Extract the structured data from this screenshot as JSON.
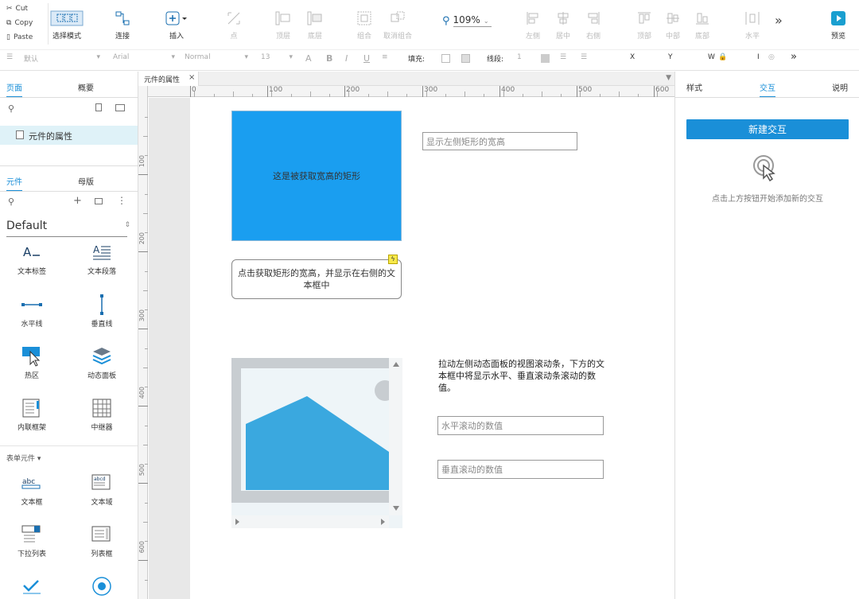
{
  "clipboard": {
    "cut": "Cut",
    "copy": "Copy",
    "paste": "Paste"
  },
  "toolbar": {
    "select_mode": "选择模式",
    "connect": "连接",
    "insert": "插入",
    "point": "点",
    "top_layer": "顶层",
    "bottom_layer": "底层",
    "group": "组合",
    "ungroup": "取消组合",
    "zoom": "109%",
    "align_left": "左侧",
    "align_center": "居中",
    "align_right": "右侧",
    "align_top": "顶部",
    "align_middle": "中部",
    "align_bottom": "底部",
    "horizontal": "水平",
    "more": "»",
    "preview": "预览"
  },
  "format": {
    "style": "默认",
    "font": "Arial",
    "weight": "Normal",
    "size": "13",
    "fill_label": "填充:",
    "line_label": "线段:",
    "line_value": "1",
    "x_label": "X",
    "y_label": "Y",
    "w_label": "W",
    "h_label": "I",
    "more": "»"
  },
  "left": {
    "tabs": {
      "pages": "页面",
      "outline": "概要"
    },
    "page_item": "元件的属性",
    "lib_tabs": {
      "widgets": "元件",
      "masters": "母版"
    },
    "library": "Default",
    "widgets": [
      {
        "label": "文本标签",
        "icon": "text-label-icon"
      },
      {
        "label": "文本段落",
        "icon": "text-paragraph-icon"
      },
      {
        "label": "水平线",
        "icon": "horizontal-line-icon"
      },
      {
        "label": "垂直线",
        "icon": "vertical-line-icon"
      },
      {
        "label": "热区",
        "icon": "hotspot-icon"
      },
      {
        "label": "动态面板",
        "icon": "dynamic-panel-icon"
      },
      {
        "label": "内联框架",
        "icon": "inline-frame-icon"
      },
      {
        "label": "中继器",
        "icon": "repeater-icon"
      }
    ],
    "form_section": "表单元件",
    "form_widgets": [
      {
        "label": "文本框",
        "icon": "text-field-icon"
      },
      {
        "label": "文本域",
        "icon": "text-area-icon"
      },
      {
        "label": "下拉列表",
        "icon": "droplist-icon"
      },
      {
        "label": "列表框",
        "icon": "listbox-icon"
      },
      {
        "label": "",
        "icon": "checkbox-icon"
      },
      {
        "label": "",
        "icon": "radio-icon"
      }
    ]
  },
  "canvas": {
    "tab_label": "元件的属性",
    "ruler_top": [
      "0",
      "100",
      "200",
      "300",
      "400",
      "500",
      "600"
    ],
    "ruler_left": [
      "100",
      "200",
      "300",
      "400",
      "500",
      "600"
    ],
    "rect_text": "这是被获取宽高的矩形",
    "rect_size_field_placeholder": "显示左侧矩形的宽高",
    "button_text": "点击获取矩形的宽高，并显示在右侧的文本框中",
    "scroll_description": "拉动左侧动态面板的视图滚动条，下方的文本框中将显示水平、垂直滚动条滚动的数值。",
    "horizontal_field_placeholder": "水平滚动的数值",
    "vertical_field_placeholder": "垂直滚动的数值",
    "accent": "#1a9ef0"
  },
  "right": {
    "tabs": {
      "style": "样式",
      "interaction": "交互",
      "notes": "说明"
    },
    "new_interaction": "新建交互",
    "hint": "点击上方按钮开始添加新的交互",
    "accent": "#1a8fd8"
  }
}
